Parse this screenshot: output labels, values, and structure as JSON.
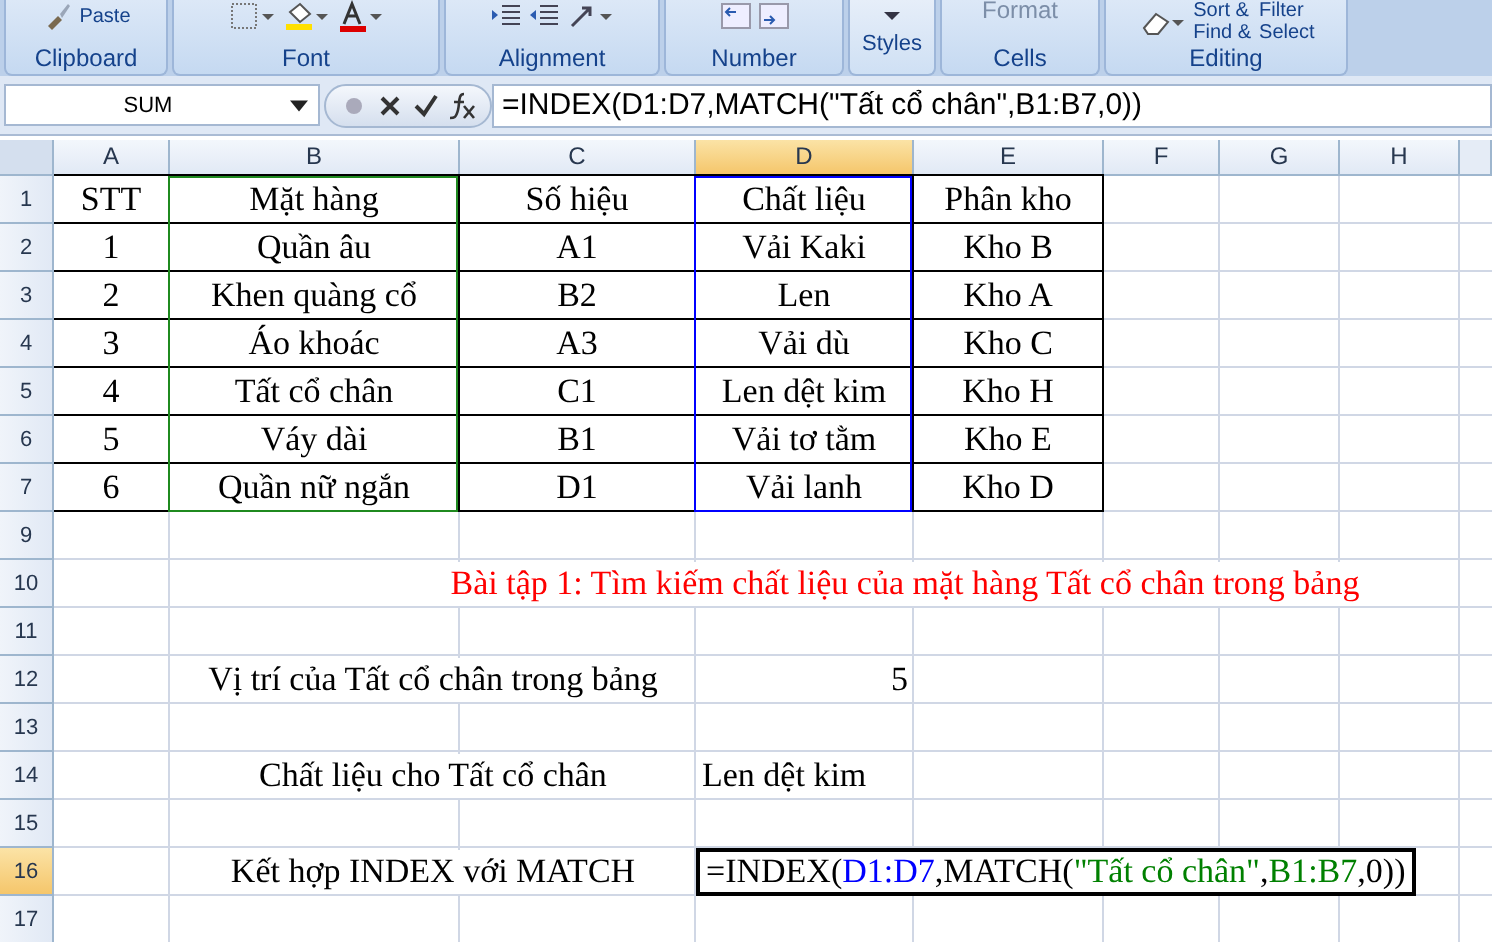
{
  "ribbon": {
    "groups": [
      {
        "kind": "clipboard",
        "label": "Clipboard",
        "texts": [
          "Paste"
        ]
      },
      {
        "kind": "font",
        "label": "Font"
      },
      {
        "kind": "alignment",
        "label": "Alignment"
      },
      {
        "kind": "number",
        "label": "Number"
      },
      {
        "kind": "styles",
        "texts": [
          "Styles"
        ]
      },
      {
        "kind": "cells",
        "label": "Cells",
        "texts": [
          "Format"
        ]
      },
      {
        "kind": "editing",
        "label": "Editing",
        "texts": [
          "Sort &",
          "Filter",
          "Find &",
          "Select"
        ]
      }
    ]
  },
  "formula_bar": {
    "name_box": "SUM",
    "formula": "=INDEX(D1:D7,MATCH(\"Tất cổ chân\",B1:B7,0))"
  },
  "columns": [
    {
      "label": "A",
      "selected": false
    },
    {
      "label": "B",
      "selected": false,
      "color": "#1f8a1f"
    },
    {
      "label": "C",
      "selected": false
    },
    {
      "label": "D",
      "selected": true,
      "color": "#0000ff"
    },
    {
      "label": "E",
      "selected": false
    },
    {
      "label": "F",
      "selected": false
    },
    {
      "label": "G",
      "selected": false
    },
    {
      "label": "H",
      "selected": false
    }
  ],
  "rows": [
    {
      "number": "1",
      "selected": false,
      "kind": "table",
      "cells": [
        "STT",
        "Mặt hàng",
        "Số hiệu",
        "Chất liệu",
        "Phân kho"
      ]
    },
    {
      "number": "2",
      "selected": false,
      "kind": "table",
      "cells": [
        "1",
        "Quần âu",
        "A1",
        "Vải Kaki",
        "Kho B"
      ]
    },
    {
      "number": "3",
      "selected": false,
      "kind": "table",
      "cells": [
        "2",
        "Khen quàng cổ",
        "B2",
        "Len",
        "Kho A"
      ]
    },
    {
      "number": "4",
      "selected": false,
      "kind": "table",
      "cells": [
        "3",
        "Áo khoác",
        "A3",
        "Vải dù",
        "Kho C"
      ]
    },
    {
      "number": "5",
      "selected": false,
      "kind": "table",
      "cells": [
        "4",
        "Tất cổ chân",
        "C1",
        "Len dệt kim",
        "Kho H"
      ]
    },
    {
      "number": "6",
      "selected": false,
      "kind": "table",
      "cells": [
        "5",
        "Váy dài",
        "B1",
        "Vải tơ tằm",
        "Kho E"
      ]
    },
    {
      "number": "7",
      "selected": false,
      "kind": "table",
      "cells": [
        "6",
        "Quần nữ ngắn",
        "D1",
        "Vải lanh",
        "Kho D"
      ]
    },
    {
      "number": "9",
      "selected": false,
      "kind": "empty"
    },
    {
      "number": "10",
      "selected": false,
      "kind": "title",
      "text": "Bài tập 1: Tìm kiếm chất liệu của mặt hàng Tất cổ chân trong bảng"
    },
    {
      "number": "11",
      "selected": false,
      "kind": "empty"
    },
    {
      "number": "12",
      "selected": false,
      "kind": "pair",
      "label": "Vị trí của Tất cổ chân trong bảng",
      "value": {
        "kind": "number",
        "active": false,
        "segments": [
          {
            "text": "5",
            "color": "#000000"
          }
        ]
      }
    },
    {
      "number": "13",
      "selected": false,
      "kind": "empty"
    },
    {
      "number": "14",
      "selected": false,
      "kind": "pair",
      "label": "Chất liệu cho Tất cổ chân",
      "value": {
        "kind": "text",
        "active": false,
        "segments": [
          {
            "text": "Len dệt kim",
            "color": "#000000"
          }
        ]
      }
    },
    {
      "number": "15",
      "selected": false,
      "kind": "empty"
    },
    {
      "number": "16",
      "selected": true,
      "kind": "pair",
      "label": "Kết hợp INDEX với MATCH",
      "value": {
        "kind": "formula",
        "active": true,
        "segments": [
          {
            "text": "=INDEX(",
            "color": "#000000"
          },
          {
            "text": "D1:D7",
            "color": "#0000ff"
          },
          {
            "text": ",MATCH(",
            "color": "#000000"
          },
          {
            "text": "\"Tất cổ chân\"",
            "color": "#008000"
          },
          {
            "text": ",",
            "color": "#000000"
          },
          {
            "text": "B1:B7",
            "color": "#008000"
          },
          {
            "text": ",0))",
            "color": "#000000"
          }
        ]
      }
    },
    {
      "number": "17",
      "selected": false,
      "kind": "empty"
    }
  ]
}
